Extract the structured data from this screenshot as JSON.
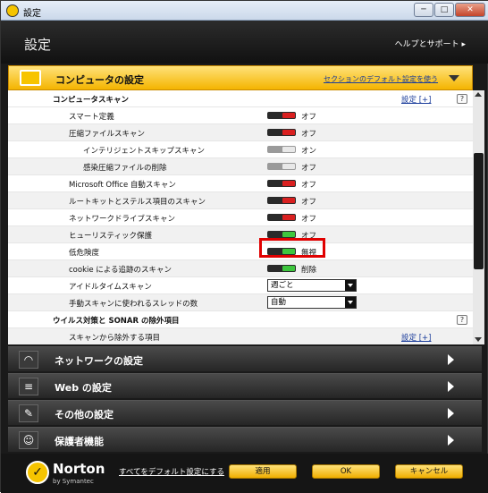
{
  "window": {
    "title": "設定",
    "buttons": [
      "─",
      "□",
      "✕"
    ]
  },
  "header": {
    "title": "設定",
    "help": "ヘルプとサポート ▸"
  },
  "section": {
    "title": "コンピュータの設定",
    "default_link": "セクションのデフォルト設定を使う"
  },
  "computer_scan": {
    "title": "コンピュータスキャン",
    "config_link": "設定 [+]",
    "help": "?",
    "rows": [
      {
        "label": "スマート定義",
        "value": "オフ"
      },
      {
        "label": "圧縮ファイルスキャン",
        "value": "オフ"
      },
      {
        "label": "インテリジェントスキップスキャン",
        "value": "オン"
      },
      {
        "label": "感染圧縮ファイルの削除",
        "value": "オフ"
      },
      {
        "label": "Microsoft Office 自動スキャン",
        "value": "オフ"
      },
      {
        "label": "ルートキットとステルス項目のスキャン",
        "value": "オフ"
      },
      {
        "label": "ネットワークドライブスキャン",
        "value": "オフ"
      },
      {
        "label": "ヒューリスティック保護",
        "value": "オフ"
      },
      {
        "label": "低危険度",
        "value": "無視"
      },
      {
        "label": "cookie による追跡のスキャン",
        "value": "削除"
      }
    ],
    "idle_scan": {
      "label": "アイドルタイムスキャン",
      "value": "週ごと"
    },
    "manual_threads": {
      "label": "手動スキャンに使われるスレッドの数",
      "value": "自動"
    }
  },
  "exclusions": {
    "title": "ウイルス対策と SONAR の除外項目",
    "help": "?",
    "row_label": "スキャンから除外する項目",
    "config_link": "設定 [+]"
  },
  "categories": [
    {
      "label": "ネットワークの設定",
      "icon": "wifi-icon"
    },
    {
      "label": "Web の設定",
      "icon": "server-icon"
    },
    {
      "label": "その他の設定",
      "icon": "wrench-icon"
    },
    {
      "label": "保護者機能",
      "icon": "family-icon"
    }
  ],
  "footer": {
    "brand": "Norton",
    "brand_sub": "by Symantec",
    "reset_link": "すべてをデフォルト設定にする",
    "apply": "適用",
    "ok": "OK",
    "cancel": "キャンセル"
  },
  "colors": {
    "accent": "#f4b400",
    "toggle_off": "#d92020",
    "toggle_on": "#3ec63e"
  }
}
